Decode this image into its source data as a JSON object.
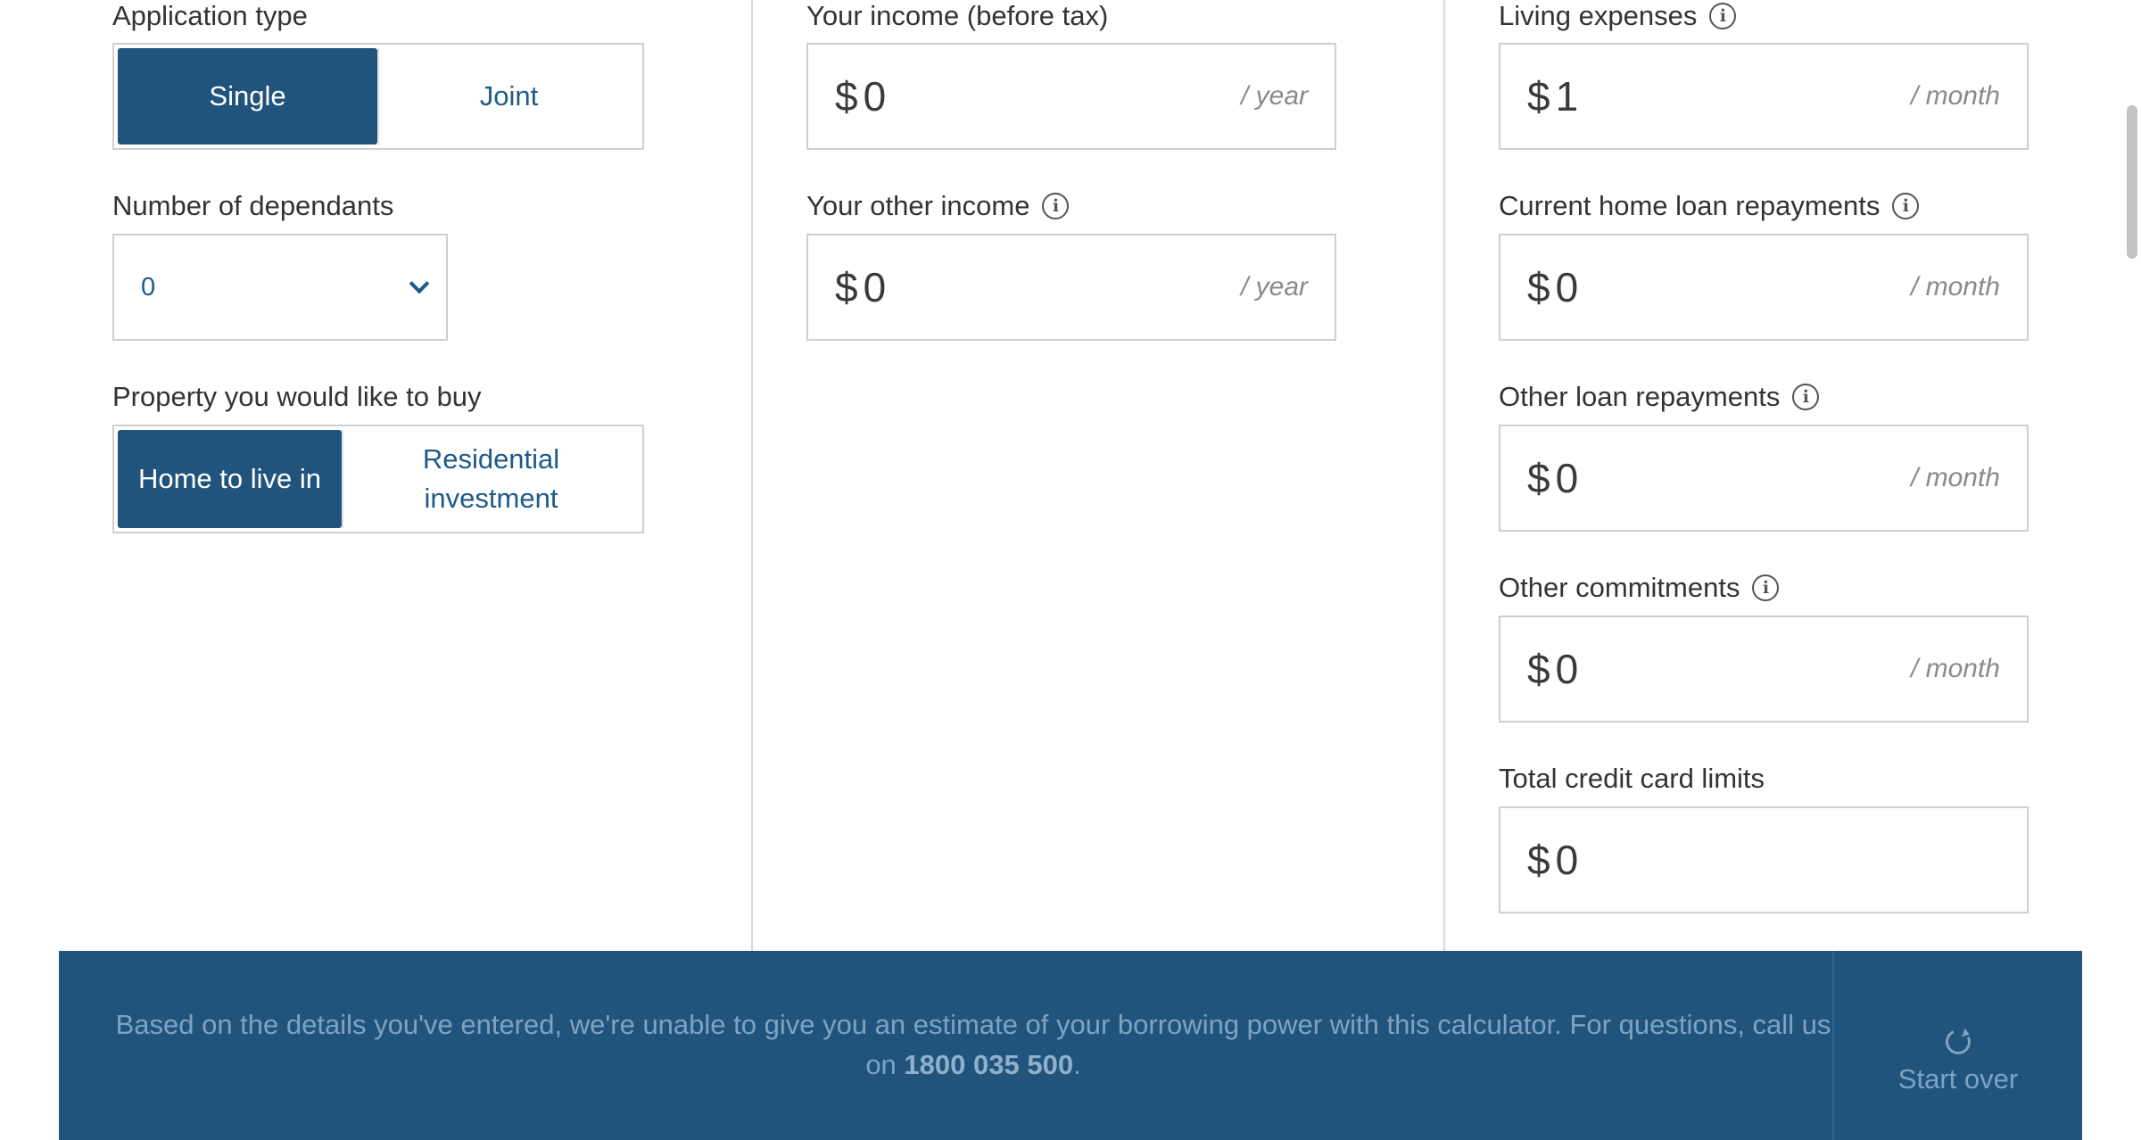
{
  "left": {
    "application_type": {
      "label": "Application type",
      "options": [
        "Single",
        "Joint"
      ],
      "selected": "Single"
    },
    "dependants": {
      "label": "Number of dependants",
      "value": "0"
    },
    "property": {
      "label": "Property you would like to buy",
      "options": [
        "Home to live in",
        "Residential investment"
      ],
      "selected": "Home to live in"
    }
  },
  "middle": {
    "income": {
      "label": "Your income (before tax)",
      "currency": "$",
      "value": "0",
      "unit": "/ year"
    },
    "other_income": {
      "label": "Your other income",
      "currency": "$",
      "value": "0",
      "unit": "/ year"
    }
  },
  "right": {
    "living_expenses": {
      "label": "Living expenses",
      "currency": "$",
      "value": "1",
      "unit": "/ month"
    },
    "home_loan": {
      "label": "Current home loan repayments",
      "currency": "$",
      "value": "0",
      "unit": "/ month"
    },
    "other_loan": {
      "label": "Other loan repayments",
      "currency": "$",
      "value": "0",
      "unit": "/ month"
    },
    "other_commitments": {
      "label": "Other commitments",
      "currency": "$",
      "value": "0",
      "unit": "/ month"
    },
    "credit_card": {
      "label": "Total credit card limits",
      "currency": "$",
      "value": "0"
    }
  },
  "banner": {
    "message": "Based on the details you've entered, we're unable to give you an estimate of your borrowing power with this calculator. For questions, call us on ",
    "phone": "1800 035 500",
    "message_end": ".",
    "start_over": "Start over"
  },
  "icons": {
    "info": "info-icon",
    "dropdown": "chevron-down-icon",
    "refresh": "refresh-icon"
  },
  "colors": {
    "accent": "#21547d",
    "link": "#1e5a8a",
    "banner_text": "#7ea3c2"
  }
}
